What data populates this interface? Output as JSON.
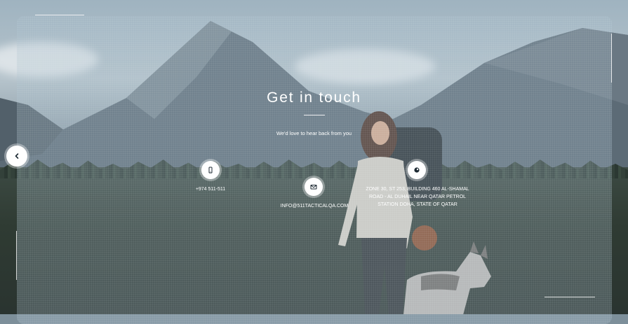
{
  "heading": "Get in touch",
  "subheading": "We'd love to hear back from you",
  "contacts": {
    "phone": "+974 511-511",
    "email": "INFO@511TACTICALQA.COM",
    "address": "ZONE 30, ST 253, BUILDING 460 AL-SHAMAL ROAD - AL DUHAIL NEAR QATAR PETROL STATION DOHA, STATE OF QATAR"
  },
  "icons": {
    "phone": "phone-icon",
    "email": "envelope-icon",
    "address": "map-pin-icon",
    "back": "chevron-left-icon"
  },
  "colors": {
    "overlay": "#aabecd",
    "text": "#ffffff",
    "icon_bg": "#ffffff",
    "icon_fg": "#1d2a33"
  }
}
